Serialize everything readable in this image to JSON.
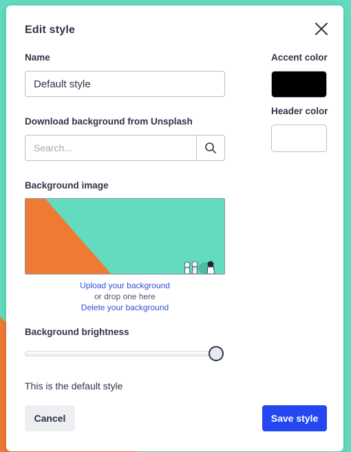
{
  "modal": {
    "title": "Edit style"
  },
  "name": {
    "label": "Name",
    "value": "Default style"
  },
  "accent_color": {
    "label": "Accent color",
    "color": "#000000"
  },
  "header_color": {
    "label": "Header color",
    "color": "#ffffff"
  },
  "unsplash": {
    "label": "Download background from Unsplash",
    "placeholder": "Search..."
  },
  "background_image": {
    "label": "Background image",
    "upload_link": "Upload your background",
    "drop_text": "or drop one here",
    "delete_link": "Delete your background"
  },
  "brightness": {
    "label": "Background brightness",
    "value_fraction": 1.0
  },
  "description": "This is the default style",
  "buttons": {
    "cancel": "Cancel",
    "save": "Save style"
  },
  "colors": {
    "page_background": "#63dbbf",
    "page_accent_shape": "#ef7a34",
    "primary_button": "#2547f1",
    "link": "#2f4ed3"
  },
  "icons": {
    "close": "close-icon",
    "search": "search-icon"
  }
}
